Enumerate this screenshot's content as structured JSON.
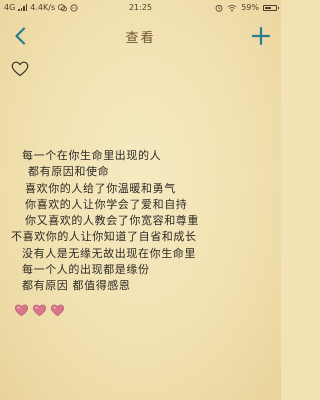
{
  "status_bar": {
    "network": "4G",
    "speed": "4.4K/s",
    "time": "21:25",
    "battery_text": "59%",
    "battery_level": 0.59
  },
  "nav": {
    "title": "查看"
  },
  "note": {
    "lines": [
      "每一个在你生命里出现的人",
      "都有原因和使命",
      "喜欢你的人给了你温暖和勇气",
      "你喜欢的人让你学会了爱和自持",
      "你又喜欢的人教会了你宽容和尊重",
      "不喜欢你的人让你知道了自省和成长",
      "没有人是无缘无故出现在你生命里",
      "每一个人的出现都是缘份",
      "都有原因 都值得感恩"
    ]
  },
  "colors": {
    "accent": "#2a7c8f",
    "text": "#2d2a26",
    "paper": "#f2e3b5",
    "heart": "#d9778a"
  }
}
